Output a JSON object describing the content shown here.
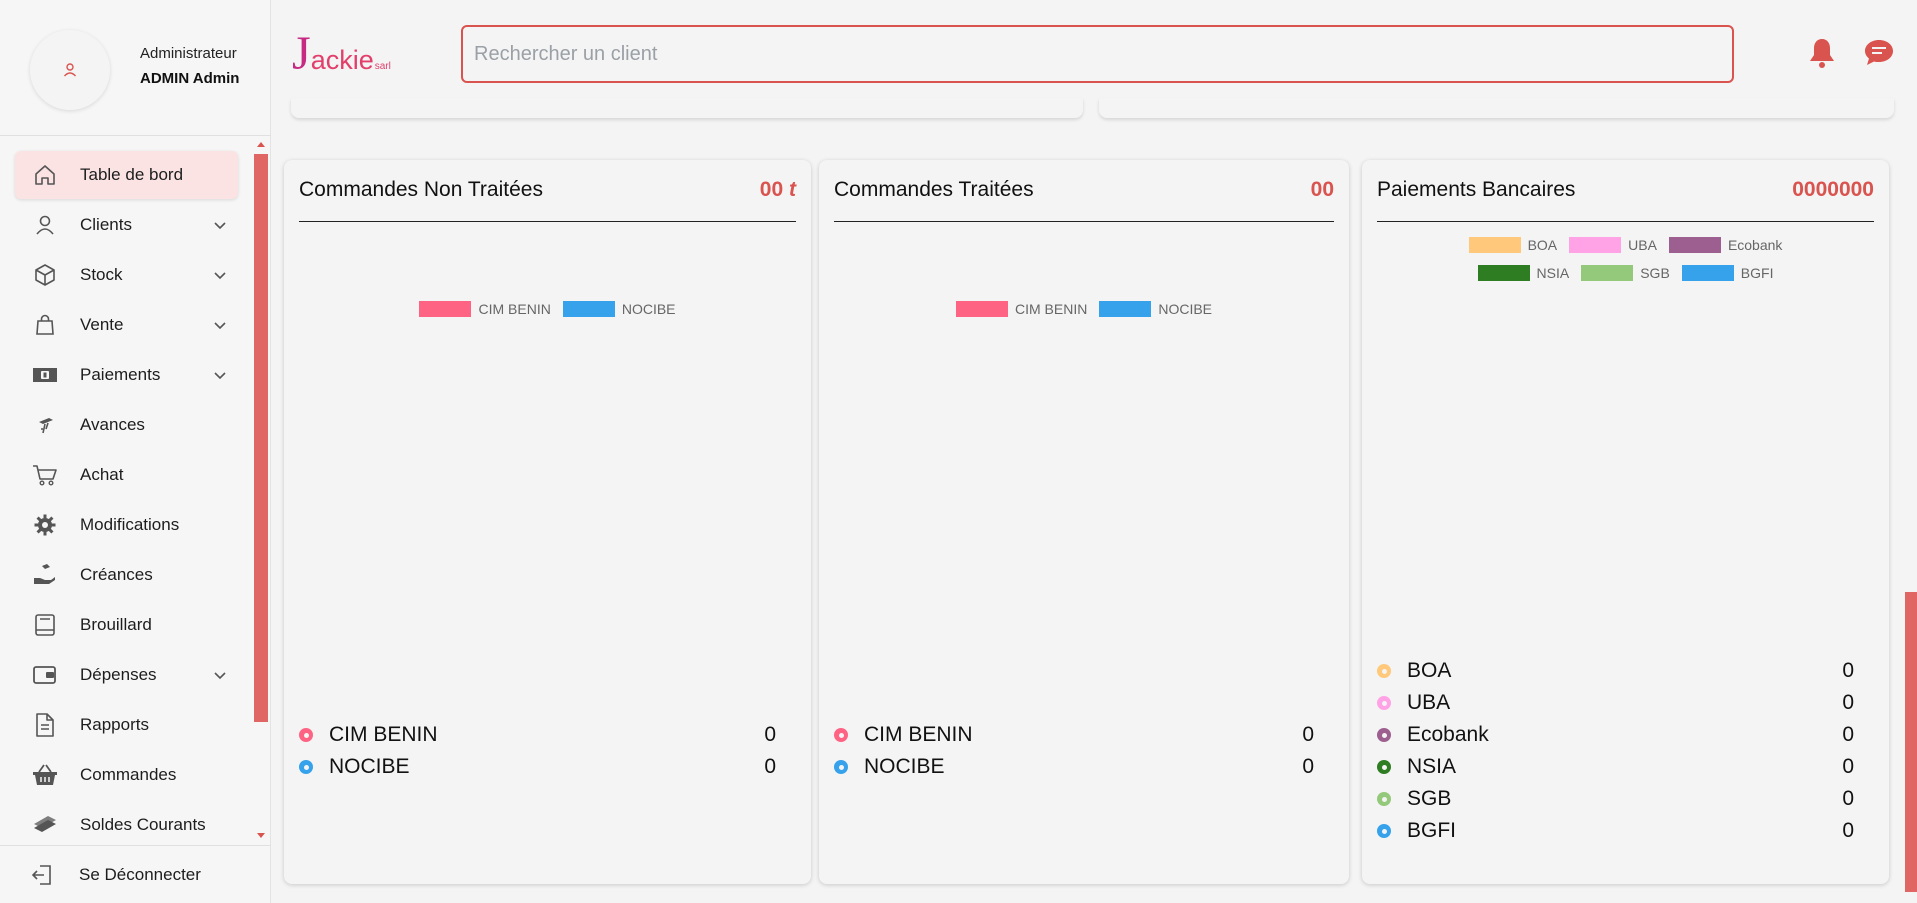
{
  "profile": {
    "role": "Administrateur",
    "name": "ADMIN Admin"
  },
  "sidebar": {
    "items": [
      {
        "label": "Table de bord",
        "icon": "home-icon",
        "active": true,
        "expandable": false
      },
      {
        "label": "Clients",
        "icon": "user-icon",
        "active": false,
        "expandable": true
      },
      {
        "label": "Stock",
        "icon": "box-icon",
        "active": false,
        "expandable": true
      },
      {
        "label": "Vente",
        "icon": "shopping-bag-icon",
        "active": false,
        "expandable": true
      },
      {
        "label": "Paiements",
        "icon": "money-icon",
        "active": false,
        "expandable": true
      },
      {
        "label": "Avances",
        "icon": "hand-coin-icon",
        "active": false,
        "expandable": false
      },
      {
        "label": "Achat",
        "icon": "cart-icon",
        "active": false,
        "expandable": false
      },
      {
        "label": "Modifications",
        "icon": "gear-icon",
        "active": false,
        "expandable": false
      },
      {
        "label": "Créances",
        "icon": "hand-money-icon",
        "active": false,
        "expandable": false
      },
      {
        "label": "Brouillard",
        "icon": "book-icon",
        "active": false,
        "expandable": false
      },
      {
        "label": "Dépenses",
        "icon": "wallet-icon",
        "active": false,
        "expandable": true
      },
      {
        "label": "Rapports",
        "icon": "document-icon",
        "active": false,
        "expandable": false
      },
      {
        "label": "Commandes",
        "icon": "basket-icon",
        "active": false,
        "expandable": false
      },
      {
        "label": "Soldes Courants",
        "icon": "money-stack-icon",
        "active": false,
        "expandable": false
      }
    ],
    "logout": "Se Déconnecter"
  },
  "header": {
    "logo_initial": "J",
    "logo_rest": "ackie",
    "logo_suffix": "sarl",
    "search_placeholder": "Rechercher un client"
  },
  "colors": {
    "accent": "#d9534f",
    "cim_benin": "#ff6384",
    "nocibe": "#36a2eb",
    "boa": "#ffc87a",
    "uba": "#ffa3e6",
    "ecobank": "#9c5f8f",
    "nsia": "#2e7d23",
    "sgb": "#94c97b",
    "bgfi": "#36a2eb"
  },
  "cards": {
    "non_traitees": {
      "title": "Commandes Non Traitées",
      "value_main": "00",
      "value_unit": "t",
      "legend": [
        "CIM BENIN",
        "NOCIBE"
      ],
      "rows": [
        {
          "name": "CIM BENIN",
          "value": "0"
        },
        {
          "name": "NOCIBE",
          "value": "0"
        }
      ]
    },
    "traitees": {
      "title": "Commandes Traitées",
      "value": "00",
      "legend": [
        "CIM BENIN",
        "NOCIBE"
      ],
      "rows": [
        {
          "name": "CIM BENIN",
          "value": "0"
        },
        {
          "name": "NOCIBE",
          "value": "0"
        }
      ]
    },
    "paiements": {
      "title": "Paiements Bancaires",
      "value": "0000000",
      "legend_row1": [
        "BOA",
        "UBA",
        "Ecobank"
      ],
      "legend_row2": [
        "NSIA",
        "SGB",
        "BGFI"
      ],
      "rows": [
        {
          "name": "BOA",
          "value": "0"
        },
        {
          "name": "UBA",
          "value": "0"
        },
        {
          "name": "Ecobank",
          "value": "0"
        },
        {
          "name": "NSIA",
          "value": "0"
        },
        {
          "name": "SGB",
          "value": "0"
        },
        {
          "name": "BGFI",
          "value": "0"
        }
      ]
    }
  }
}
